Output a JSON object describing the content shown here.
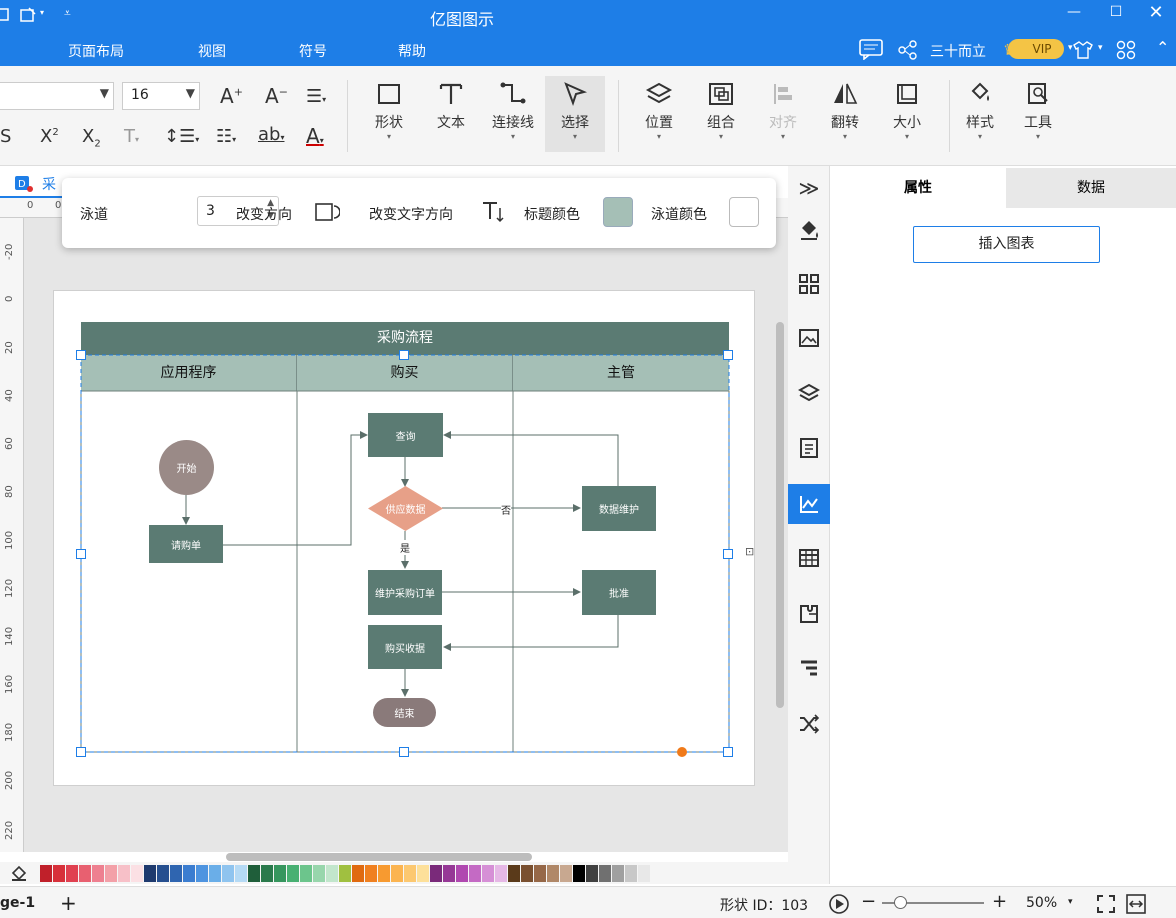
{
  "app": {
    "title": "亿图图示"
  },
  "menu": [
    "页面布局",
    "视图",
    "符号",
    "帮助"
  ],
  "account": {
    "user": "三十而立",
    "vip": "VIP"
  },
  "toolbar": {
    "font_size": "16",
    "buttons": [
      {
        "label": "形状",
        "icon": "rectangle-icon"
      },
      {
        "label": "文本",
        "icon": "text-icon"
      },
      {
        "label": "连接线",
        "icon": "connector-icon"
      },
      {
        "label": "选择",
        "icon": "cursor-icon"
      },
      {
        "label": "位置",
        "icon": "layers-icon"
      },
      {
        "label": "组合",
        "icon": "group-icon"
      },
      {
        "label": "对齐",
        "icon": "align-icon"
      },
      {
        "label": "翻转",
        "icon": "flip-icon"
      },
      {
        "label": "大小",
        "icon": "size-icon"
      },
      {
        "label": "样式",
        "icon": "fill-icon"
      },
      {
        "label": "工具",
        "icon": "tools-icon"
      }
    ]
  },
  "doc_tab": {
    "name": "采"
  },
  "swimlane_bar": {
    "lanes_label": "泳道",
    "lanes_value": "3",
    "change_direction": "改变方向",
    "change_text_direction": "改变文字方向",
    "title_color_label": "标题颜色",
    "title_color": "#a5bfb6",
    "lane_color_label": "泳道颜色",
    "lane_color": "#ffffff"
  },
  "ruler": {
    "top": [
      "0",
      "0"
    ],
    "left": [
      "-20",
      "0",
      "20",
      "40",
      "60",
      "80",
      "100",
      "120",
      "140",
      "160",
      "180",
      "200",
      "220"
    ]
  },
  "diagram": {
    "title": "采购流程",
    "lanes": [
      "应用程序",
      "购买",
      "主管"
    ],
    "nodes": {
      "start": "开始",
      "request": "请购单",
      "query": "查询",
      "supply": "供应数据",
      "maintain_data": "数据维护",
      "maintain_order": "维护采购订单",
      "approve": "批准",
      "receipt": "购买收据",
      "end": "结束"
    },
    "edge_labels": {
      "no": "否",
      "yes": "是"
    }
  },
  "right_panel": {
    "tabs": [
      "属性",
      "数据"
    ],
    "insert_chart": "插入图表"
  },
  "status": {
    "page": "ge-1",
    "shape_id": "形状 ID：103",
    "zoom": "50%"
  },
  "palette": [
    "#c0202a",
    "#d7303a",
    "#e04050",
    "#e86070",
    "#ee8090",
    "#f3a0a8",
    "#f7c0c8",
    "#fbe0e4",
    "#1e3a6e",
    "#264f8f",
    "#2f65b0",
    "#3b7dd0",
    "#4e94e0",
    "#6aaee8",
    "#8fc4ef",
    "#b5daf5",
    "#1f5e3a",
    "#2a7a4c",
    "#36965e",
    "#48b072",
    "#6cc58c",
    "#98d6ac",
    "#c2e6cc",
    "#a0c040",
    "#e06a10",
    "#f08020",
    "#f79a30",
    "#fbb450",
    "#fcc870",
    "#fde09a",
    "#7a2a7a",
    "#963896",
    "#b048b0",
    "#c46ac4",
    "#d690d6",
    "#e6b8e6",
    "#5a3a1a",
    "#7a5030",
    "#966848",
    "#b08868",
    "#c8a890",
    "#000000",
    "#404040",
    "#707070",
    "#a0a0a0",
    "#c8c8c8",
    "#e8e8e8"
  ]
}
